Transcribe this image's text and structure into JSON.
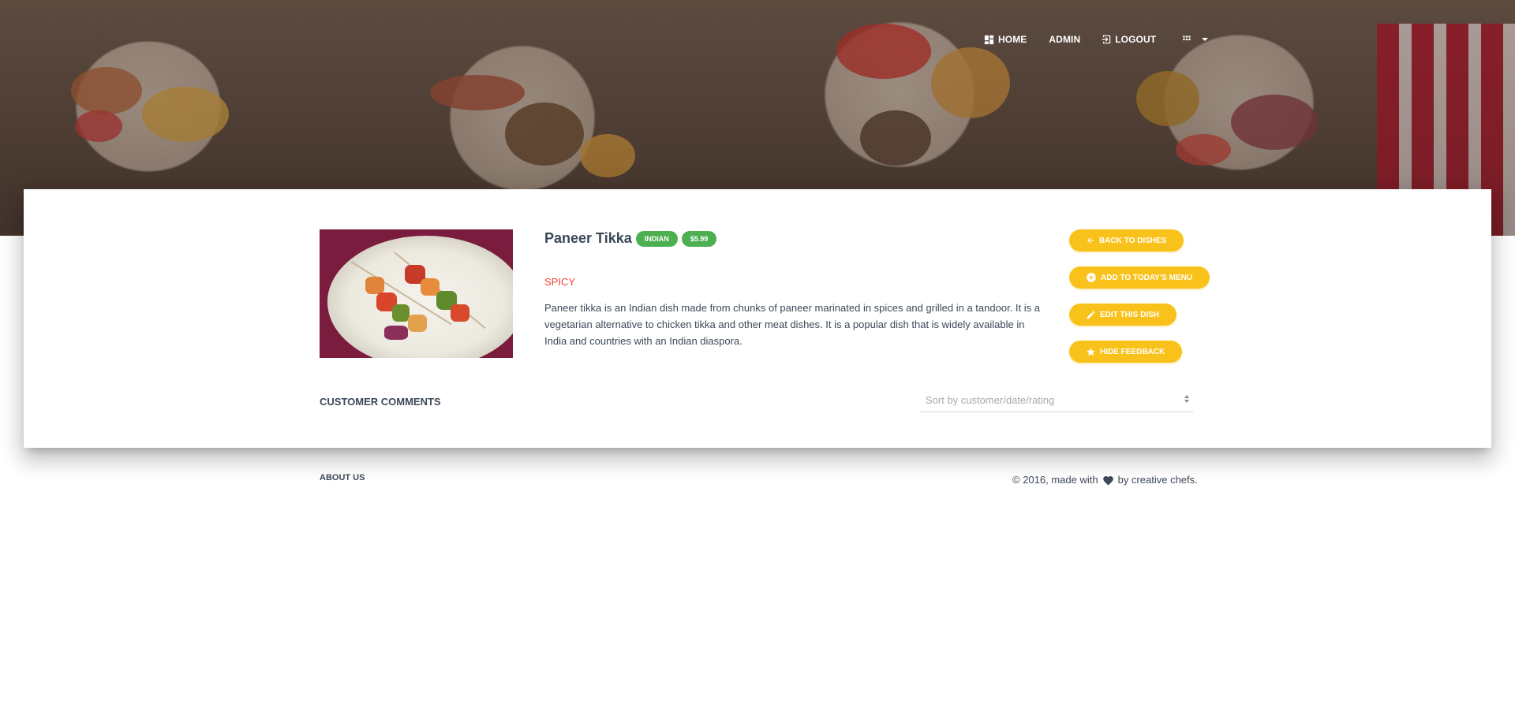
{
  "nav": {
    "home": "HOME",
    "admin": "ADMIN",
    "logout": "LOGOUT"
  },
  "dish": {
    "title": "Paneer Tikka",
    "badges": [
      "INDIAN",
      "$5.99"
    ],
    "tag": "SPICY",
    "description": "Paneer tikka is an Indian dish made from chunks of paneer marinated in spices and grilled in a tandoor. It is a vegetarian alternative to chicken tikka and other meat dishes. It is a popular dish that is widely available in India and countries with an Indian diaspora."
  },
  "actions": {
    "back": "BACK TO DISHES",
    "add": "ADD TO TODAY'S MENU",
    "edit": "EDIT THIS DISH",
    "hide": "HIDE FEEDBACK"
  },
  "comments": {
    "title": "CUSTOMER COMMENTS",
    "sort_placeholder": "Sort by customer/date/rating"
  },
  "footer": {
    "about": "ABOUT US",
    "copyright_prefix": "© 2016, made with",
    "copyright_suffix": "by creative chefs."
  },
  "colors": {
    "accent": "#f9c21b",
    "badge": "#4caf50",
    "spicy": "#f44336"
  },
  "icons": {
    "home": "dashboard-icon",
    "logout": "login-icon",
    "apps": "apps-icon",
    "back": "arrow-back-icon",
    "add": "add-circle-icon",
    "edit": "edit-icon",
    "hide": "star-icon",
    "heart": "heart-icon"
  }
}
